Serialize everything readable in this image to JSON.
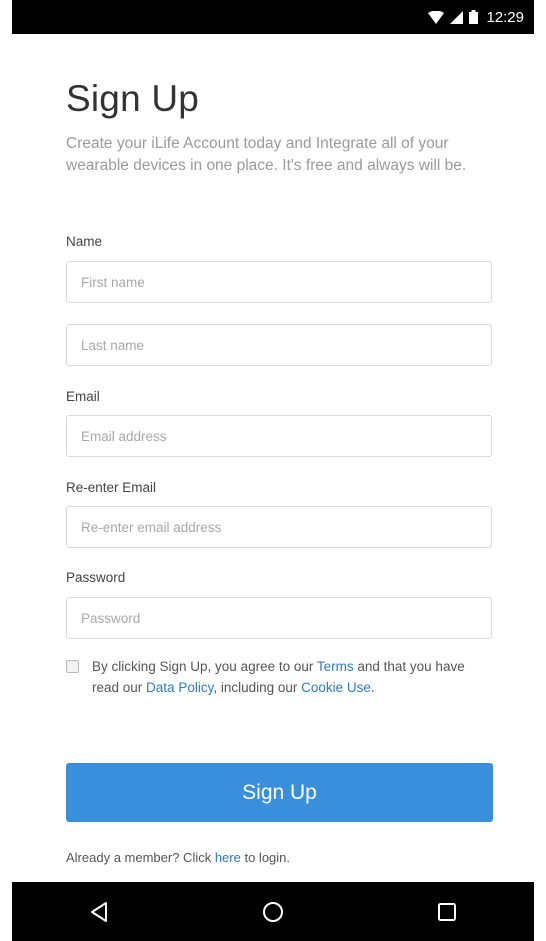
{
  "status_bar": {
    "time": "12:29",
    "icons": [
      "wifi-icon",
      "signal-icon",
      "battery-icon"
    ]
  },
  "header": {
    "title": "Sign Up",
    "subtitle": "Create your iLife Account today and Integrate all of your wearable devices in one place. It's free and always will be."
  },
  "form": {
    "name_label": "Name",
    "first_name_placeholder": "First name",
    "first_name_value": "",
    "last_name_placeholder": "Last name",
    "last_name_value": "",
    "email_label": "Email",
    "email_placeholder": "Email address",
    "email_value": "",
    "reenter_email_label": "Re-enter Email",
    "reenter_email_placeholder": "Re-enter email address",
    "reenter_email_value": "",
    "password_label": "Password",
    "password_placeholder": "Password",
    "password_value": ""
  },
  "agreement": {
    "checked": false,
    "text_1": "By clicking Sign Up, you agree to our ",
    "terms_link": "Terms",
    "text_2": " and that you have read our ",
    "data_policy_link": "Data Policy",
    "text_3": ", including our ",
    "cookie_link": "Cookie Use",
    "text_4": "."
  },
  "signup_button": {
    "label": "Sign Up"
  },
  "login": {
    "text_1": "Already a member? Click ",
    "link": "here",
    "text_2": " to login."
  },
  "nav_bar": {
    "icons": [
      "back-icon",
      "home-icon",
      "recents-icon"
    ]
  },
  "colors": {
    "accent": "#3a8fdd",
    "link": "#2f7bbf",
    "subtitle_text": "#9a9a9a",
    "system_bar": "#000000"
  }
}
